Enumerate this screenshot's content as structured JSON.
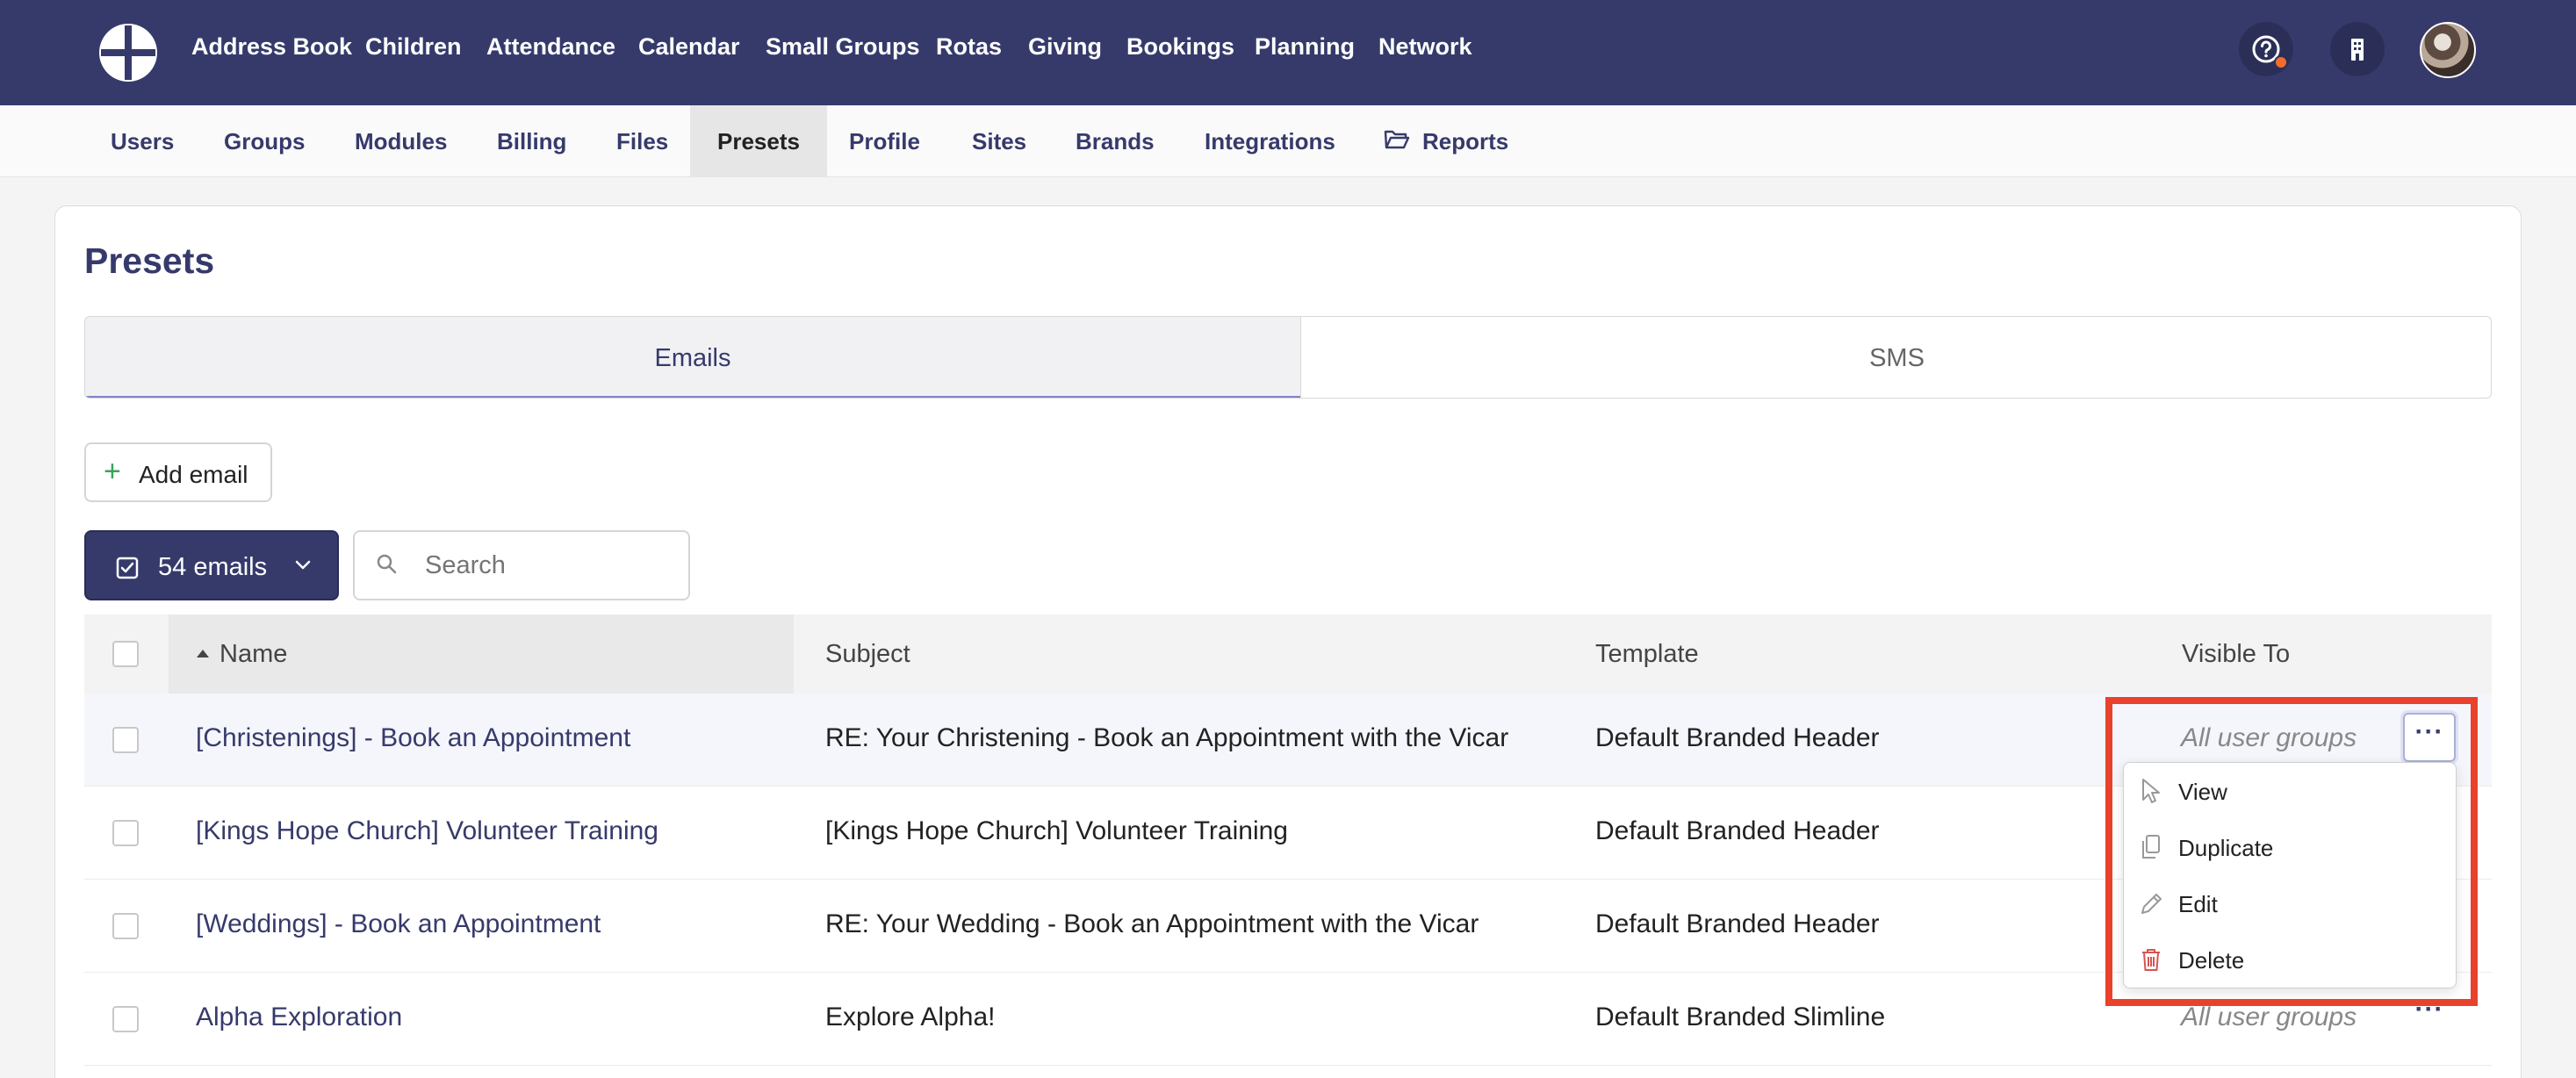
{
  "topnav": {
    "items": [
      "Address Book",
      "Children",
      "Attendance",
      "Calendar",
      "Small Groups",
      "Rotas",
      "Giving",
      "Bookings",
      "Planning",
      "Network"
    ]
  },
  "subnav": {
    "items": [
      "Users",
      "Groups",
      "Modules",
      "Billing",
      "Files",
      "Presets",
      "Profile",
      "Sites",
      "Brands",
      "Integrations",
      "Reports"
    ],
    "active": "Presets"
  },
  "page": {
    "title": "Presets"
  },
  "tabs": [
    {
      "label": "Emails",
      "active": true
    },
    {
      "label": "SMS",
      "active": false
    }
  ],
  "actions": {
    "add_label": "Add email",
    "count_label": "54 emails",
    "search_placeholder": "Search"
  },
  "table": {
    "columns": [
      "Name",
      "Subject",
      "Template",
      "Visible To"
    ],
    "rows": [
      {
        "name": "[Christenings] - Book an Appointment",
        "subject": "RE: Your Christening - Book an Appointment with the Vicar",
        "template": "Default Branded Header",
        "visible": "All user groups"
      },
      {
        "name": "[Kings Hope Church] Volunteer Training",
        "subject": "[Kings Hope Church] Volunteer Training",
        "template": "Default Branded Header",
        "visible": ""
      },
      {
        "name": "[Weddings] - Book an Appointment",
        "subject": "RE: Your Wedding - Book an Appointment with the Vicar",
        "template": "Default Branded Header",
        "visible": ""
      },
      {
        "name": "Alpha Exploration",
        "subject": "Explore Alpha!",
        "template": "Default Branded Slimline",
        "visible": "All user groups"
      }
    ]
  },
  "row_menu": {
    "items": [
      "View",
      "Duplicate",
      "Edit",
      "Delete"
    ]
  },
  "colors": {
    "primary": "#363a6b",
    "accent_red": "#e8412c",
    "add_green": "#3aa35a",
    "delete_red": "#d9534f"
  }
}
